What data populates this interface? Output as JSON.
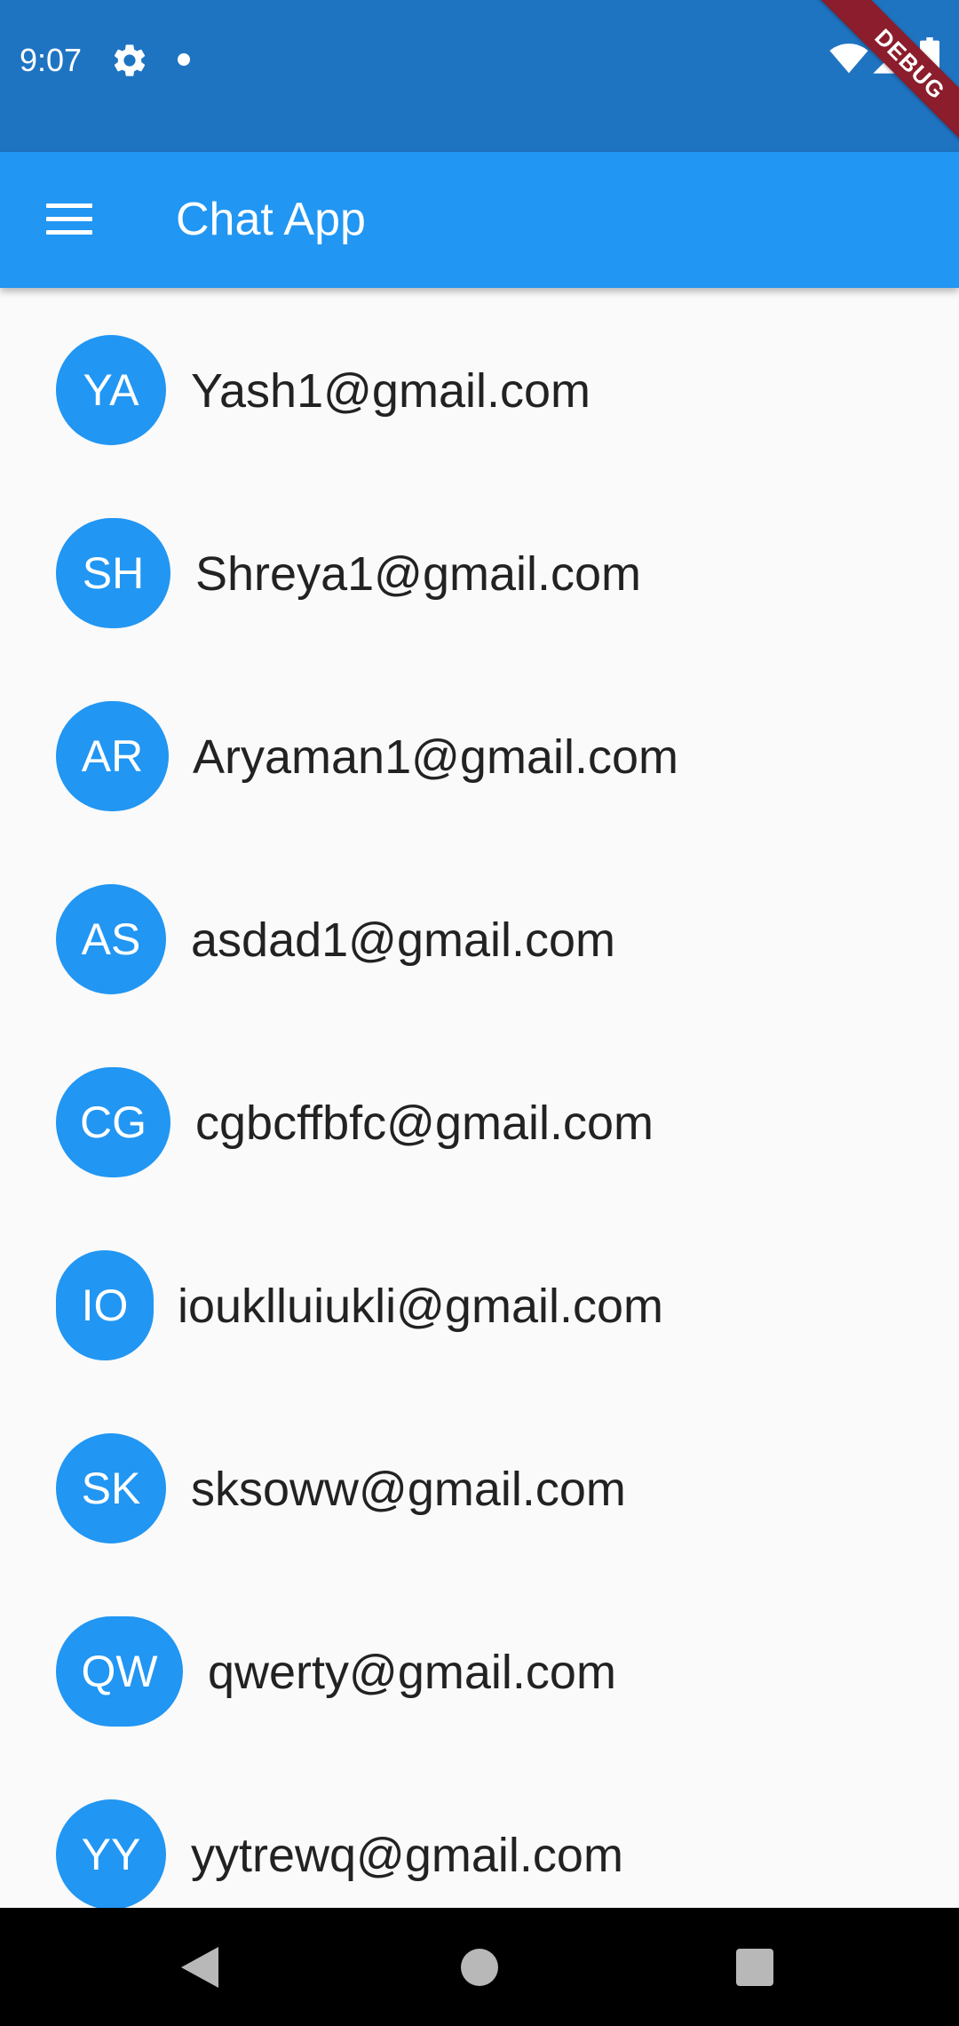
{
  "status_bar": {
    "time": "9:07",
    "icons": [
      "gear-icon",
      "notification-dot-icon",
      "wifi-icon",
      "signal-icon",
      "battery-icon"
    ]
  },
  "debug_banner": "DEBUG",
  "app_bar": {
    "title": "Chat App",
    "menu_icon": "menu-icon",
    "background_color": "#2196f3"
  },
  "colors": {
    "status_bar": "#1f74c2",
    "avatar": "#2196f3",
    "background": "#fafafa",
    "debug_banner": "#8b1d2c"
  },
  "contacts": [
    {
      "initials": "YA",
      "email": "Yash1@gmail.com"
    },
    {
      "initials": "SH",
      "email": "Shreya1@gmail.com"
    },
    {
      "initials": "AR",
      "email": "Aryaman1@gmail.com"
    },
    {
      "initials": "AS",
      "email": "asdad1@gmail.com"
    },
    {
      "initials": "CG",
      "email": "cgbcffbfc@gmail.com"
    },
    {
      "initials": "IO",
      "email": "iouklluiukli@gmail.com"
    },
    {
      "initials": "SK",
      "email": "sksoww@gmail.com"
    },
    {
      "initials": "QW",
      "email": "qwerty@gmail.com"
    },
    {
      "initials": "YY",
      "email": "yytrewq@gmail.com"
    }
  ],
  "nav_bar": {
    "buttons": [
      "back-icon",
      "home-icon",
      "recents-icon"
    ]
  }
}
